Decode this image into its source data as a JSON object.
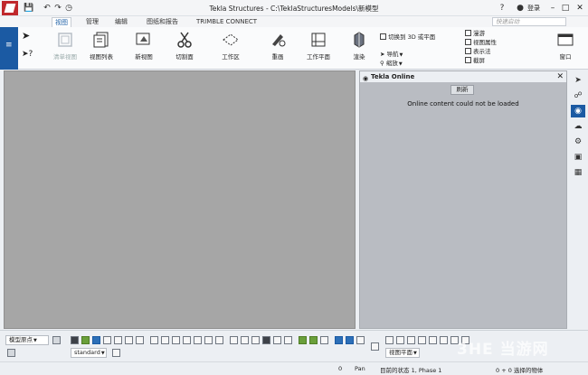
{
  "app": {
    "title": "Tekla Structures - C:\\TeklaStructuresModels\\新模型",
    "login_label": "登录",
    "help_icon": "?"
  },
  "tabs": [
    {
      "label": "视图",
      "active": true
    },
    {
      "label": "管理",
      "active": false
    },
    {
      "label": "编辑",
      "active": false
    },
    {
      "label": "图纸和报告",
      "active": false
    },
    {
      "label": "TRIMBLE CONNECT",
      "active": false
    }
  ],
  "quick_search": {
    "placeholder": "快速启动"
  },
  "ribbon": {
    "buttons": [
      {
        "label": "清单视图",
        "disabled": true
      },
      {
        "label": "视图列表"
      },
      {
        "label": "新视图"
      },
      {
        "label": "切割面"
      },
      {
        "label": "工作区"
      },
      {
        "label": "重画"
      },
      {
        "label": "工作平面"
      },
      {
        "label": "渲染"
      },
      {
        "label": "窗口"
      }
    ],
    "switch_3d": "切换到 3D 或平面",
    "navigate": "导航",
    "zoom": "缩放",
    "right_items": [
      "漫游",
      "视图属性",
      "表示法",
      "截屏"
    ]
  },
  "panel": {
    "title": "Tekla Online",
    "refresh_label": "刷新",
    "message": "Online content could not be loaded"
  },
  "bottom": {
    "snap_mode": "模型原点",
    "standard_select": "standard",
    "view_plane_select": "视图平面"
  },
  "status": {
    "count": "0",
    "mode": "Pan",
    "state": "目前的状态 1, Phase 1",
    "selected": "0 + 0 选择的物体"
  },
  "watermark": "3HE 当游网"
}
